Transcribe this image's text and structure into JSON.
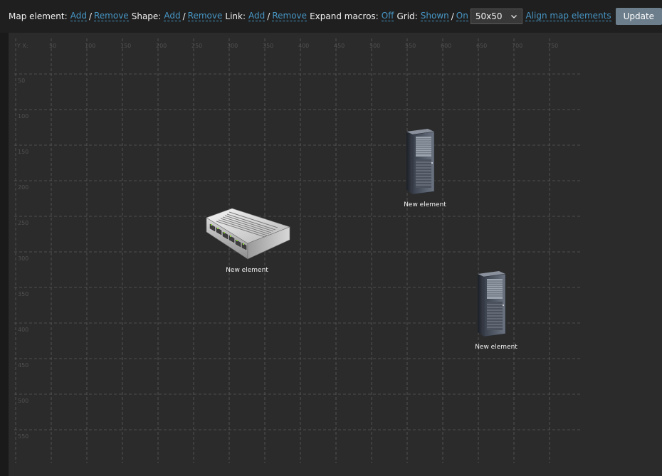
{
  "toolbar": {
    "map_element_label": "Map element:",
    "shape_label": "Shape:",
    "link_label": "Link:",
    "expand_macros_label": "Expand macros:",
    "grid_label": "Grid:",
    "add_text": "Add",
    "remove_text": "Remove",
    "slash": "/",
    "expand_macros_value": "Off",
    "grid_shown_value": "Shown",
    "grid_on_value": "On",
    "grid_size_selected": "50x50",
    "align_label": "Align map elements",
    "update_label": "Update"
  },
  "map": {
    "corner_label": "Y X:",
    "x_ticks": [
      "50",
      "100",
      "150",
      "200",
      "250",
      "300",
      "350",
      "400",
      "450",
      "500",
      "550",
      "600",
      "650",
      "700",
      "750"
    ],
    "y_ticks": [
      "50",
      "100",
      "150",
      "200",
      "250",
      "300",
      "350",
      "400",
      "450",
      "500",
      "550"
    ],
    "elements": [
      {
        "icon": "switch-icon",
        "label": "New element"
      },
      {
        "icon": "server-rack-icon",
        "label": "New element"
      },
      {
        "icon": "server-rack-icon",
        "label": "New element"
      }
    ]
  },
  "colors": {
    "toolbar_bg": "#1f1f1f",
    "map_bg": "#2b2b2b",
    "link": "#4796c4",
    "button_bg": "#6c7e8c",
    "grid_line": "#5a5a5a"
  }
}
